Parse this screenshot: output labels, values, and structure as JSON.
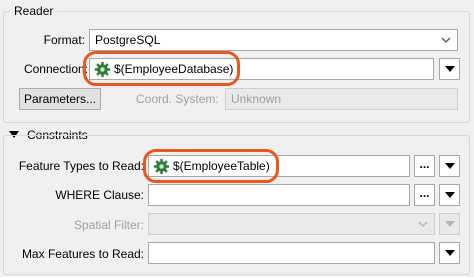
{
  "reader": {
    "group_title": "Reader",
    "format_label": "Format:",
    "format_value": "PostgreSQL",
    "connection_label": "Connection:",
    "connection_value": "$(EmployeeDatabase)",
    "parameters_button": "Parameters...",
    "coord_label": "Coord. System:",
    "coord_value": "Unknown"
  },
  "constraints": {
    "section_title": "Constraints",
    "feature_types_label": "Feature Types to Read:",
    "feature_types_value": "$(EmployeeTable)",
    "where_label": "WHERE Clause:",
    "spatial_label": "Spatial Filter:",
    "max_features_label": "Max Features to Read:",
    "ellipsis": "..."
  },
  "colors": {
    "highlight": "#e8591f",
    "gear_icon": "#2f7d3a"
  }
}
